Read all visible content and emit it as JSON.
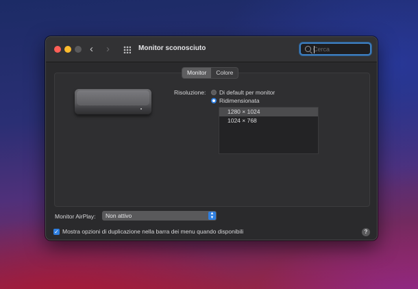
{
  "window": {
    "title": "Monitor sconosciuto",
    "back_glyph": "‹",
    "forward_glyph": "›"
  },
  "search": {
    "placeholder": "Cerca",
    "value": ""
  },
  "tabs": [
    {
      "label": "Monitor",
      "active": true
    },
    {
      "label": "Colore",
      "active": false
    }
  ],
  "resolution": {
    "label": "Risoluzione:",
    "options": [
      {
        "label": "Di default per monitor",
        "selected": false
      },
      {
        "label": "Ridimensionata",
        "selected": true
      }
    ],
    "list": [
      {
        "label": "1280 × 1024",
        "selected": true
      },
      {
        "label": "1024 × 768",
        "selected": false
      }
    ]
  },
  "airplay": {
    "label": "Monitor AirPlay:",
    "value": "Non attivo"
  },
  "mirroring": {
    "label": "Mostra opzioni di duplicazione nella barra dei menu quando disponibili",
    "checked": true
  },
  "help_glyph": "?",
  "colors": {
    "accent": "#2f7fe0",
    "window_bg": "#2a2a2c"
  }
}
